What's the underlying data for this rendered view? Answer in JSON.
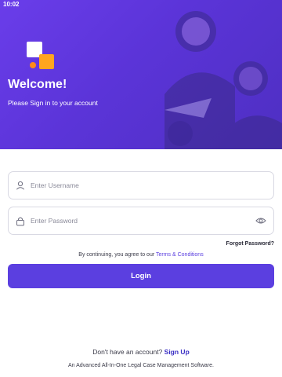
{
  "status_bar": {
    "time": "10:02"
  },
  "header": {
    "title": "Welcome!",
    "subtitle": "Please Sign in to your account"
  },
  "form": {
    "username_placeholder": "Enter Username",
    "password_placeholder": "Enter Password",
    "forgot_label": "Forgot Password?",
    "terms_prefix": "By continuing, you agree to our ",
    "terms_link": "Terms & Conditions",
    "login_label": "Login"
  },
  "footer": {
    "signup_prompt": "Don't have an account? ",
    "signup_link": "Sign Up",
    "tagline": "An Advanced All-In-One Legal Case Management Software."
  },
  "colors": {
    "brand_purple": "#5b3fe0",
    "accent_orange": "#ffa51f"
  },
  "icons": {
    "username": "user-icon",
    "password": "lock-icon",
    "toggle": "eye-icon"
  }
}
